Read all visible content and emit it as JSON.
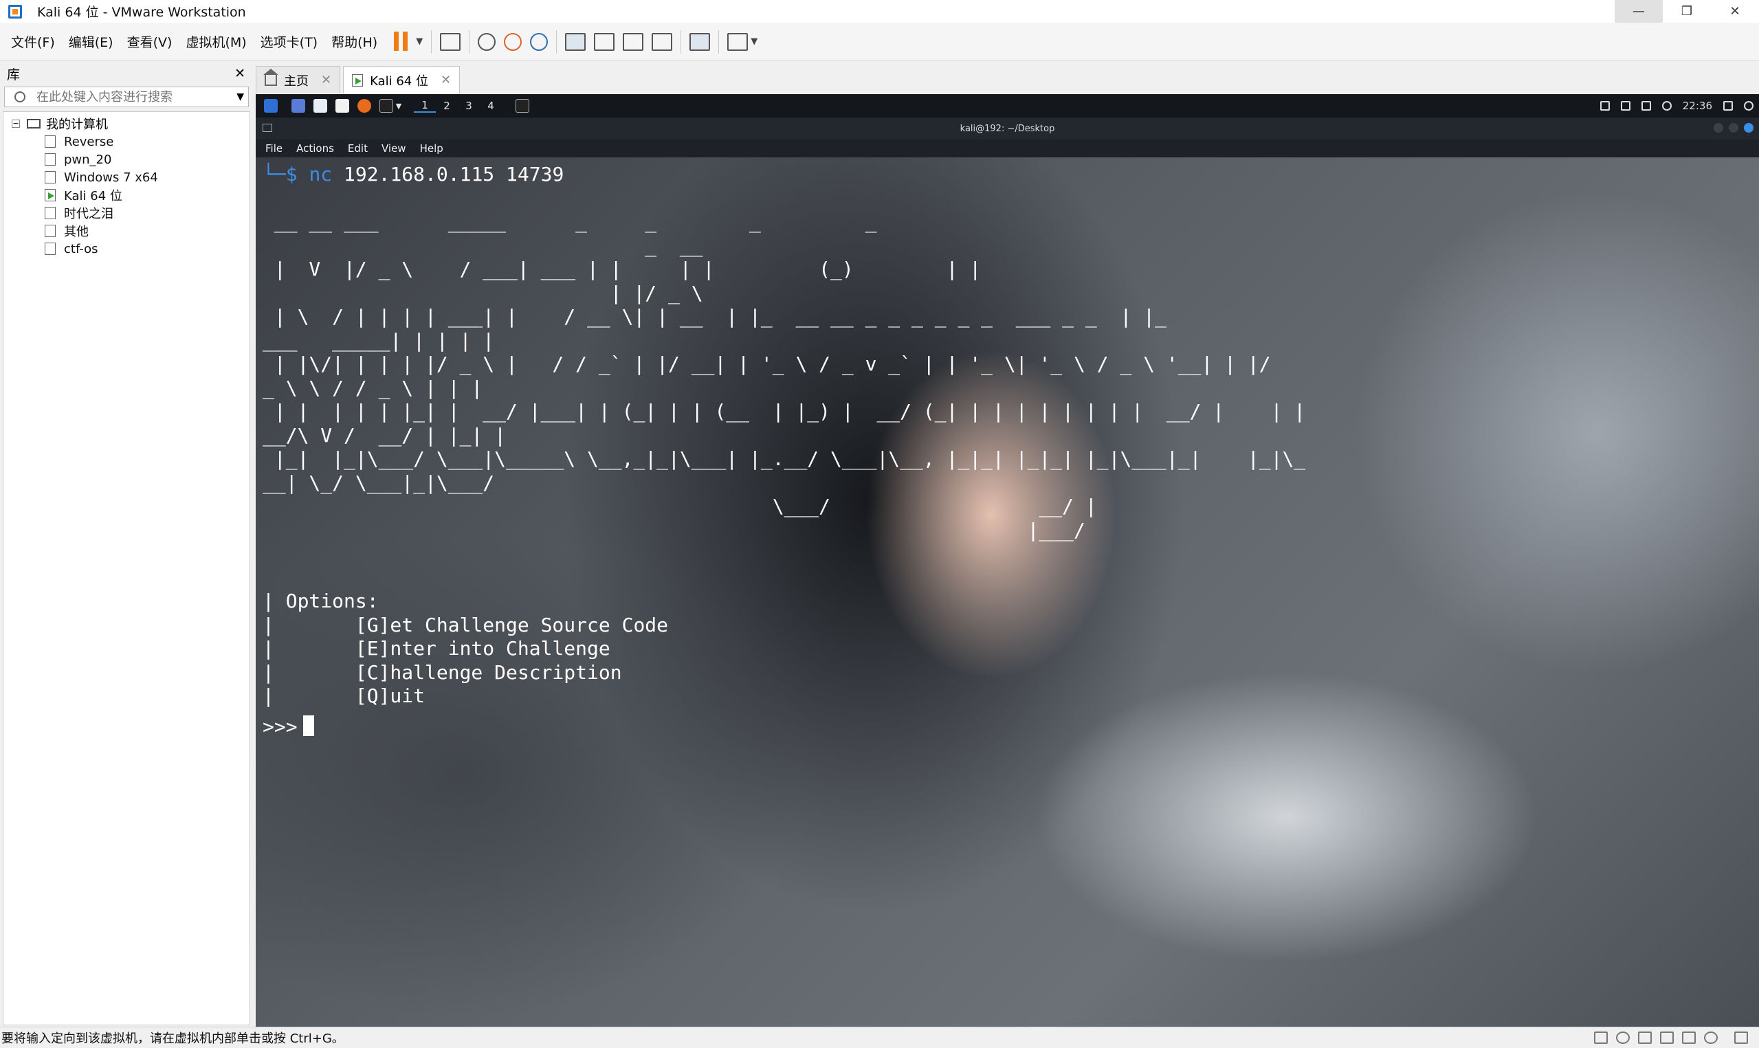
{
  "window": {
    "title": "Kali 64 位 - VMware Workstation",
    "min": "—",
    "restore": "❐",
    "close": "✕"
  },
  "menu": [
    "文件(F)",
    "编辑(E)",
    "查看(V)",
    "虚拟机(M)",
    "选项卡(T)",
    "帮助(H)"
  ],
  "library": {
    "title": "库",
    "close": "✕",
    "search_placeholder": "在此处键入内容进行搜索",
    "root": "我的计算机",
    "items": [
      "Reverse",
      "pwn_20",
      "Windows 7 x64",
      "Kali 64 位",
      "时代之泪",
      "其他",
      "ctf-os"
    ],
    "running_item": "Kali 64 位"
  },
  "tabs": [
    {
      "label": "主页",
      "close": "✕"
    },
    {
      "label": "Kali 64 位",
      "close": "✕"
    }
  ],
  "kali": {
    "workspaces": [
      "1",
      "2",
      "3",
      "4"
    ],
    "clock": "22:36",
    "terminal_title": "kali@192: ~/Desktop",
    "terminal_menu": [
      "File",
      "Actions",
      "Edit",
      "View",
      "Help"
    ]
  },
  "terminal": {
    "prompt_corner": "└─$",
    "cmd_name": "nc",
    "cmd_args": "192.168.0.115 14739",
    "ascii_art": " __ __ ___      _____      _     _        _         _\n                                 _  __\n |  V  |/ _ \\    / ___| ___ | |     | |         (_)        | |\n                              | |/ _ \\\n | \\  / | | | | ___| |    / __ \\| | __  | |_  __ __ _ _ _ _ _ _  ___ _ _  | |_\n___   _____| | | | |\n | |\\/| | | | |/ _ \\ |   / / _` | |/ __| | '_ \\ / _ v _` | | '_ \\| '_ \\ / _ \\ '__| | |/\n_ \\ \\ / / _ \\ | | |\n | |  | | | |_| |  __/ |___| | (_| | | (__  | |_) |  __/ (_| | | | | | | | |  __/ |    | |\n__/\\ V /  __/ | |_| |\n |_|  |_|\\___/ \\___|\\_____\\ \\__,_|_|\\___| |_.__/ \\___|\\__, |_|_| |_|_| |_|\\___|_|    |_|\\_\n__| \\_/ \\___|_|\\___/\n                                            \\___/                  __/ |\n                                                                  |___/",
    "options": [
      "| Options:",
      "|       [G]et Challenge Source Code",
      "|       [E]nter into Challenge",
      "|       [C]hallenge Description",
      "|       [Q]uit"
    ],
    "input_prompt": ">>>"
  },
  "status": {
    "text": "要将输入定向到该虚拟机，请在虚拟机内部单击或按 Ctrl+G。"
  }
}
